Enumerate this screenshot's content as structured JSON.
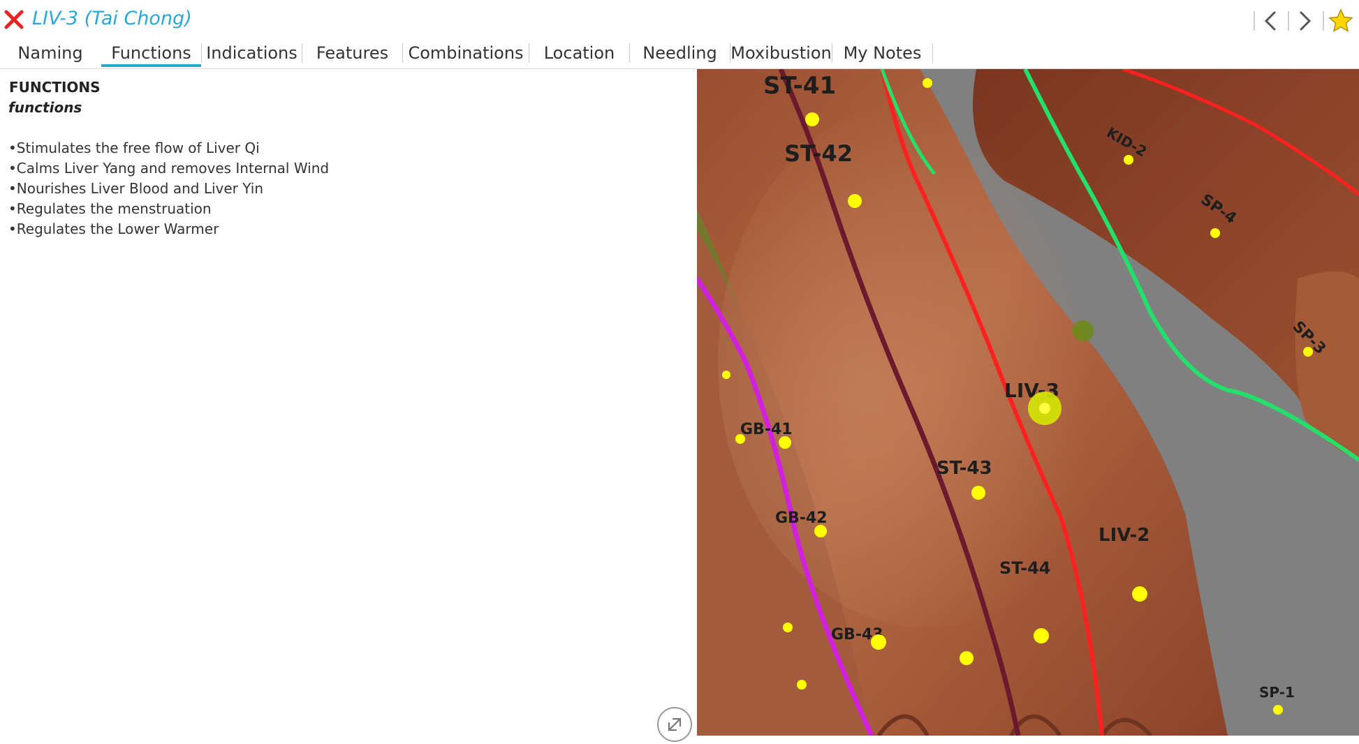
{
  "window": {
    "title": "LIV-3 (Tai Chong)",
    "close_icon": "close-x-icon",
    "prev_icon": "chevron-left-icon",
    "next_icon": "chevron-right-icon",
    "favorite_icon": "star-icon",
    "accent_color": "#2aa7d6"
  },
  "tabs": [
    {
      "label": "Naming"
    },
    {
      "label": "Functions",
      "active": true
    },
    {
      "label": "Indications"
    },
    {
      "label": "Features"
    },
    {
      "label": "Combinations"
    },
    {
      "label": "Location"
    },
    {
      "label": "Needling"
    },
    {
      "label": "Moxibustion"
    },
    {
      "label": "My Notes"
    }
  ],
  "content": {
    "heading": "FUNCTIONS",
    "subheading": "functions",
    "items": [
      "•Stimulates the free flow of Liver Qi",
      "•Calms Liver Yang and removes Internal Wind",
      "•Nourishes Liver Blood and Liver Yin",
      "•Regulates the menstruation",
      "•Regulates the Lower Warmer"
    ],
    "expand_icon": "expand-arrows-icon"
  },
  "viewer": {
    "points": [
      "ST-41",
      "ST-42",
      "ST-43",
      "ST-44",
      "LIV-3",
      "LIV-2",
      "GB-41",
      "GB-42",
      "GB-43",
      "SP-4",
      "SP-3",
      "SP-1",
      "KID-2"
    ],
    "selected_point": "LIV-3",
    "meridian_colors": {
      "stomach": "#6b1a2e",
      "liver": "#ff2020",
      "gallbladder": "#d21fe0",
      "spleen": "#22e06a"
    },
    "point_color": "#ffff00"
  }
}
